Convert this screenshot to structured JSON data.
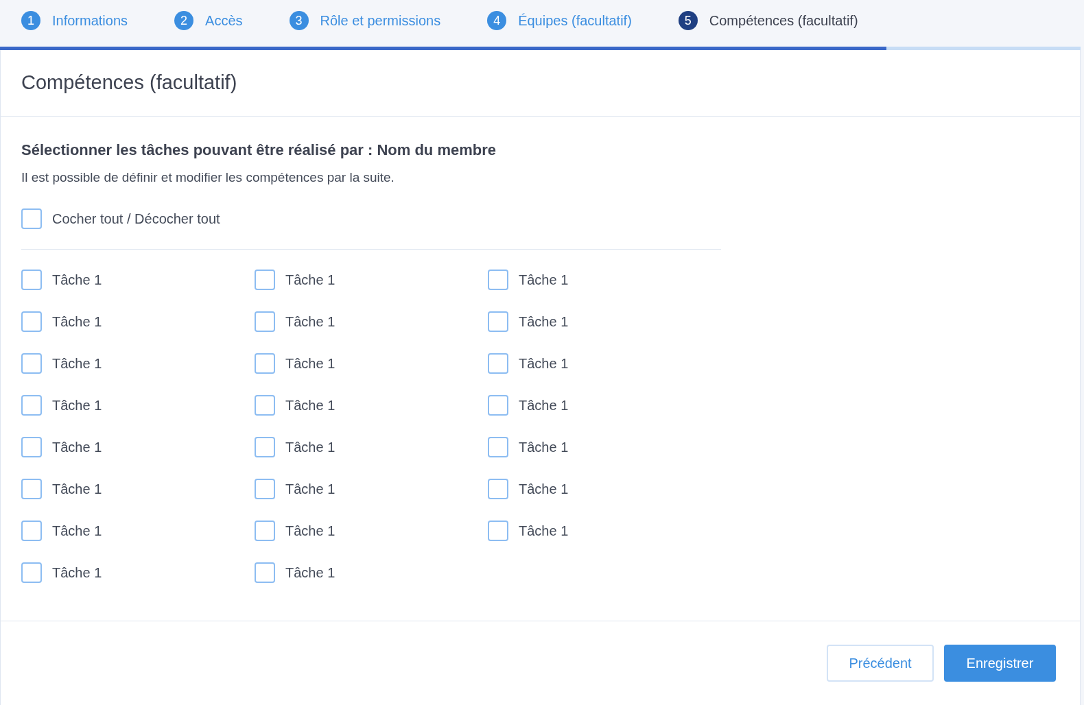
{
  "steps": [
    {
      "number": "1",
      "label": "Informations",
      "selected": false
    },
    {
      "number": "2",
      "label": "Accès",
      "selected": false
    },
    {
      "number": "3",
      "label": "Rôle et permissions",
      "selected": false
    },
    {
      "number": "4",
      "label": "Équipes (facultatif)",
      "selected": false
    },
    {
      "number": "5",
      "label": "Compétences (facultatif)",
      "selected": true
    }
  ],
  "progress": {
    "level": 0.82
  },
  "card": {
    "title": "Compétences (facultatif)",
    "heading": "Sélectionner les tâches pouvant être réalisé par : Nom du membre",
    "description": "Il est possible de définir et modifier les compétences par la suite.",
    "check_all": {
      "label": "Cocher tout / Décocher tout",
      "checked": false
    },
    "tasks": [
      {
        "label": "Tâche 1",
        "checked": false
      },
      {
        "label": "Tâche 1",
        "checked": false
      },
      {
        "label": "Tâche 1",
        "checked": false
      },
      {
        "label": "Tâche 1",
        "checked": false
      },
      {
        "label": "Tâche 1",
        "checked": false
      },
      {
        "label": "Tâche 1",
        "checked": false
      },
      {
        "label": "Tâche 1",
        "checked": false
      },
      {
        "label": "Tâche 1",
        "checked": false
      },
      {
        "label": "Tâche 1",
        "checked": false
      },
      {
        "label": "Tâche 1",
        "checked": false
      },
      {
        "label": "Tâche 1",
        "checked": false
      },
      {
        "label": "Tâche 1",
        "checked": false
      },
      {
        "label": "Tâche 1",
        "checked": false
      },
      {
        "label": "Tâche 1",
        "checked": false
      },
      {
        "label": "Tâche 1",
        "checked": false
      },
      {
        "label": "Tâche 1",
        "checked": false
      },
      {
        "label": "Tâche 1",
        "checked": false
      },
      {
        "label": "Tâche 1",
        "checked": false
      },
      {
        "label": "Tâche 1",
        "checked": false
      },
      {
        "label": "Tâche 1",
        "checked": false
      },
      {
        "label": "Tâche 1",
        "checked": false
      },
      {
        "label": "Tâche 1",
        "checked": false
      },
      {
        "label": "Tâche 1",
        "checked": false
      }
    ]
  },
  "buttons": [
    {
      "label": "Précédent",
      "kind": "secondary"
    },
    {
      "label": "Enregistrer",
      "kind": "primary"
    }
  ]
}
